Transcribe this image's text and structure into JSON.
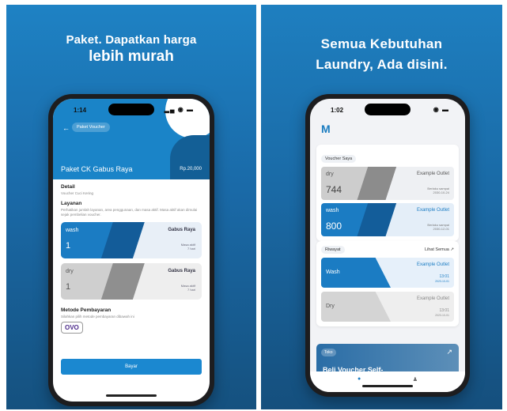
{
  "left": {
    "headline": [
      "Paket. Dapatkan harga",
      "lebih murah"
    ],
    "phone": {
      "time": "1:14",
      "status_icons": "▂▄ ◉ ▬",
      "back_icon": "←",
      "nav_pill": "Paket Voucher",
      "package_title": "Paket CK Gabus Raya",
      "price": "Rp.20,000",
      "detail_title": "Detail",
      "detail_sub": "Voucher Cuci Kering",
      "services_title": "Layanan",
      "services_sub": "Perhatikan jumlah layanan, area penggunaan, dan masa aktif. Masa aktif akan dimulai sejak pembelian voucher.",
      "services": [
        {
          "name": "wash",
          "qty": "1",
          "outlet": "Gabus Raya",
          "validity": "Masa aktif",
          "days": "7 hari"
        },
        {
          "name": "dry",
          "qty": "1",
          "outlet": "Gabus Raya",
          "validity": "Masa aktif",
          "days": "7 hari"
        }
      ],
      "payment_title": "Metode Pembayaran",
      "payment_sub": "Silahkan pilih metode pembayaran dibawah ini",
      "payment_option": "OVO",
      "pay_button": "Bayar"
    }
  },
  "right": {
    "headline": [
      "Semua Kebutuhan",
      "Laundry, Ada disini."
    ],
    "phone": {
      "time": "1:02",
      "status_icons": "◉ ▬",
      "logo": "M",
      "voucher_tag": "Voucher Saya",
      "vouchers": [
        {
          "name": "dry",
          "qty": "744",
          "outlet": "Example Outlet",
          "valid_label": "Berlaku sampai",
          "valid_date": "2030-10-24"
        },
        {
          "name": "wash",
          "qty": "800",
          "outlet": "Example Outlet",
          "valid_label": "Berlaku sampai",
          "valid_date": "2030-12-01"
        }
      ],
      "history_tag": "Riwayat",
      "see_all": "Lihat Semua ↗",
      "history": [
        {
          "name": "Wash",
          "outlet": "Example Outlet",
          "time": "13:01",
          "date": "2023-10-01"
        },
        {
          "name": "Dry",
          "outlet": "Example Outlet",
          "time": "13:01",
          "date": "2023-10-01"
        }
      ],
      "promo_tag": "Toko",
      "promo_arrow": "↗",
      "promo_title": "Beli Voucher Self-",
      "tab_home_icon": "●",
      "tab_profile_icon": "♟"
    }
  }
}
